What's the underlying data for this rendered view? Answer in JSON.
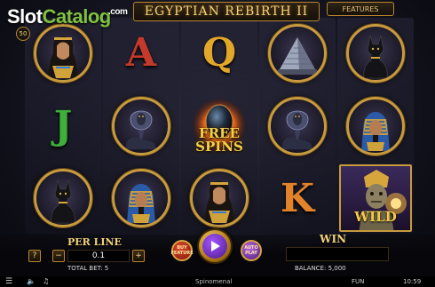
{
  "header": {
    "watermark_part1": "Slot",
    "watermark_part2": "Catalog",
    "watermark_suffix": ".com",
    "title": "EGYPTIAN REBIRTH II",
    "features_label": "FEATURES",
    "lines_count": "50"
  },
  "reels": [
    [
      {
        "symbol": "queen-portrait"
      },
      {
        "symbol": "letter-j",
        "text": "J"
      },
      {
        "symbol": "cat-statue"
      }
    ],
    [
      {
        "symbol": "letter-a",
        "text": "A"
      },
      {
        "symbol": "cobra"
      },
      {
        "symbol": "pharaoh"
      }
    ],
    [
      {
        "symbol": "letter-q",
        "text": "Q"
      },
      {
        "symbol": "free-spins-egg",
        "text": "FREE SPINS"
      },
      {
        "symbol": "queen-portrait"
      }
    ],
    [
      {
        "symbol": "pyramid"
      },
      {
        "symbol": "cobra"
      },
      {
        "symbol": "letter-k",
        "text": "K"
      }
    ],
    [
      {
        "symbol": "cat-statue"
      },
      {
        "symbol": "pharaoh"
      },
      {
        "symbol": "wild-mummy",
        "text": "WILD"
      }
    ]
  ],
  "controls": {
    "help_label": "?",
    "perline_label": "PER LINE",
    "perline_value": "0.1",
    "minus_label": "−",
    "plus_label": "+",
    "total_bet": "TOTAL BET: 5",
    "buy_label": "BUY FEATURE",
    "auto_label": "AUTO PLAY",
    "win_label": "WIN",
    "win_value": "",
    "balance": "BALANCE: 5,000"
  },
  "statusbar": {
    "brand": "Spinomenal",
    "mode": "FUN",
    "clock": "10:59"
  },
  "colors": {
    "gold": "#c79a3e",
    "title_gold": "#f2d27a",
    "watermark_green": "#7fc241",
    "spin_purple": "#a455ff"
  }
}
